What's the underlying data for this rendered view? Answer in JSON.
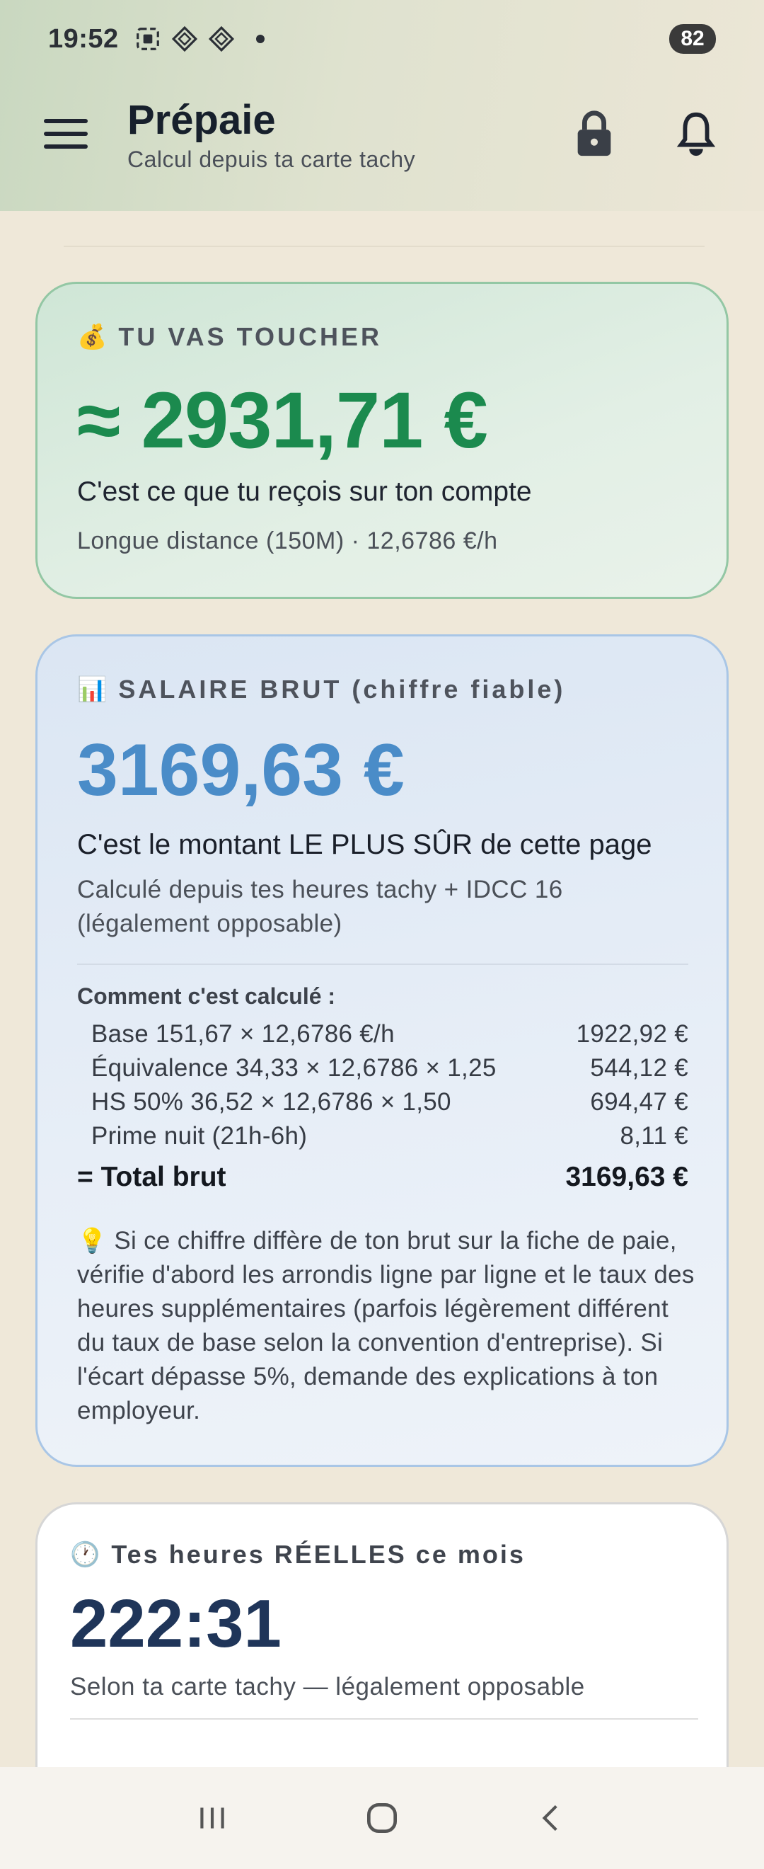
{
  "status_bar": {
    "time": "19:52",
    "battery": "82",
    "icons": [
      "screenshot-icon",
      "app-icon",
      "app-icon",
      "notification-dot",
      "wifi-icon",
      "signal-icon"
    ]
  },
  "header": {
    "title": "Prépaie",
    "subtitle": "Calcul depuis ta carte tachy",
    "icons": [
      "menu-icon",
      "lock-icon",
      "bell-icon"
    ]
  },
  "net_card": {
    "icon": "💰",
    "label": "TU VAS TOUCHER",
    "amount": "≈ 2931,71 €",
    "description": "C'est ce que tu reçois sur ton compte",
    "meta": "Longue distance (150M) · 12,6786 €/h"
  },
  "brut_card": {
    "icon": "📊",
    "label": "SALAIRE BRUT (chiffre fiable)",
    "amount": "3169,63 €",
    "headline": "C'est le montant LE PLUS SÛR de cette page",
    "subline": "Calculé depuis tes heures tachy + IDCC 16 (légalement opposable)",
    "calc_title": "Comment c'est calculé :",
    "rows": [
      {
        "label": "Base 151,67 × 12,6786 €/h",
        "value": "1922,92 €"
      },
      {
        "label": "Équivalence 34,33 × 12,6786 × 1,25",
        "value": "544,12 €"
      },
      {
        "label": "HS 50% 36,52 × 12,6786 × 1,50",
        "value": "694,47 €"
      },
      {
        "label": "Prime nuit (21h-6h)",
        "value": "8,11 €"
      }
    ],
    "total_label": "= Total brut",
    "total_value": "3169,63 €",
    "tip_icon": "💡",
    "tip": "Si ce chiffre diffère de ton brut sur la fiche de paie, vérifie d'abord les arrondis ligne par ligne et le taux des heures supplémentaires (parfois légèrement différent du taux de base selon la convention d'entreprise). Si l'écart dépasse 5%, demande des explications à ton employeur."
  },
  "hours_card": {
    "icon": "🕐",
    "label": "Tes heures RÉELLES ce mois",
    "amount": "222:31",
    "subline": "Selon ta carte tachy — légalement opposable"
  },
  "colors": {
    "net_green": "#1b8a4e",
    "brut_blue": "#4a8cc8",
    "hours_navy": "#1f3559"
  },
  "nav_bar": {
    "icons": [
      "recents-icon",
      "home-icon",
      "back-icon"
    ]
  }
}
